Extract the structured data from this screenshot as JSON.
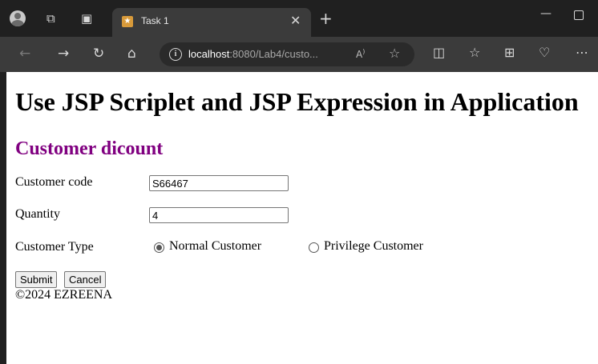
{
  "browser": {
    "tab_title": "Task 1",
    "address": {
      "host": "localhost",
      "rest": ":8080/Lab4/custo..."
    }
  },
  "icons": {
    "profile": "avatar-icon",
    "workspaces": "workspaces-icon",
    "tab_actions": "tab-actions-icon",
    "favicon": "app-favicon",
    "close_tab": "close-icon",
    "new_tab": "plus-icon",
    "back": "arrow-left-icon",
    "forward": "arrow-right-icon",
    "refresh": "refresh-icon",
    "home": "home-icon",
    "site_info": "info-icon",
    "read_aloud": "read-aloud-icon",
    "favorite": "star-icon",
    "split_screen": "split-screen-icon",
    "favorites": "favorites-icon",
    "collections": "collections-icon",
    "browser_essentials": "heartbeat-icon",
    "more": "more-icon"
  },
  "page": {
    "title": "Use JSP Scriplet and JSP Expression in Application",
    "subtitle": "Customer dicount",
    "form": {
      "customer_code_label": "Customer code",
      "customer_code_value": "S66467",
      "quantity_label": "Quantity",
      "quantity_value": "4",
      "customer_type_label": "Customer Type",
      "options": [
        "Normal Customer",
        "Privilege Customer"
      ],
      "selected_option": "Normal Customer",
      "submit_label": "Submit",
      "cancel_label": "Cancel"
    },
    "footer": "©2024 EZREENA"
  },
  "colors": {
    "chrome_bg": "#202020",
    "toolbar_bg": "#3b3b3b",
    "subtitle": "#800080"
  }
}
